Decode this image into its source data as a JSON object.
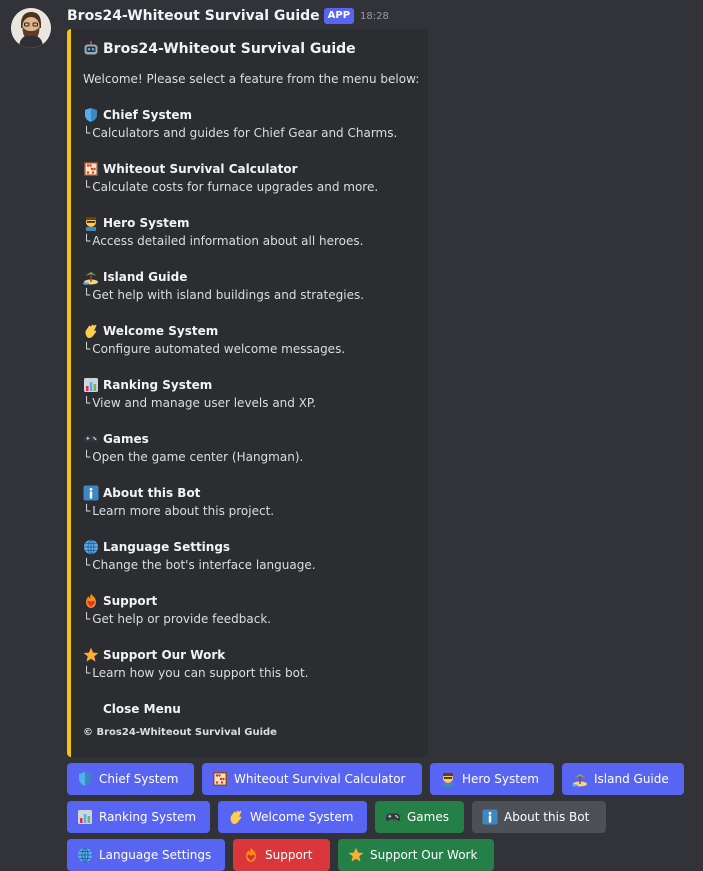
{
  "message": {
    "username": "Bros24-Whiteout Survival Guide",
    "app_tag": "APP",
    "time": "18:28"
  },
  "embed": {
    "title": "Bros24-Whiteout Survival Guide",
    "description": "Welcome! Please select a feature from the menu below:",
    "accent_color": "#f1c40f",
    "corner_glyph": "└",
    "features": [
      {
        "icon": "shield-icon",
        "title": "Chief System",
        "desc": "Calculators and guides for Chief Gear and Charms."
      },
      {
        "icon": "abacus-icon",
        "title": "Whiteout Survival Calculator",
        "desc": "Calculate costs for furnace upgrades and more."
      },
      {
        "icon": "hero-icon",
        "title": "Hero System",
        "desc": "Access detailed information about all heroes."
      },
      {
        "icon": "island-icon",
        "title": "Island Guide",
        "desc": "Get help with island buildings and strategies."
      },
      {
        "icon": "wave-icon",
        "title": "Welcome System",
        "desc": "Configure automated welcome messages."
      },
      {
        "icon": "chart-icon",
        "title": "Ranking System",
        "desc": "View and manage user levels and XP."
      },
      {
        "icon": "gamepad-icon",
        "title": "Games",
        "desc": "Open the game center (Hangman)."
      },
      {
        "icon": "info-icon",
        "title": "About this Bot",
        "desc": "Learn more about this project."
      },
      {
        "icon": "globe-icon",
        "title": "Language Settings",
        "desc": "Change the bot's interface language."
      },
      {
        "icon": "fire-heart-icon",
        "title": "Support",
        "desc": "Get help or provide feedback."
      },
      {
        "icon": "star-icon",
        "title": "Support Our Work",
        "desc": "Learn how you can support this bot."
      }
    ],
    "close": {
      "icon": "close-icon",
      "title": "Close Menu"
    },
    "footer": "© Bros24-Whiteout Survival Guide"
  },
  "buttons": {
    "chief": "Chief System",
    "calculator": "Whiteout Survival Calculator",
    "hero": "Hero System",
    "island": "Island Guide",
    "ranking": "Ranking System",
    "welcome": "Welcome System",
    "games": "Games",
    "about": "About this Bot",
    "language": "Language Settings",
    "support": "Support",
    "support_work": "Support Our Work"
  },
  "colors": {
    "blurple": "#5865f2",
    "green": "#248046",
    "grey": "#4e5058",
    "red": "#da373c",
    "background": "#313338",
    "embed_bg": "#2b2d31"
  }
}
